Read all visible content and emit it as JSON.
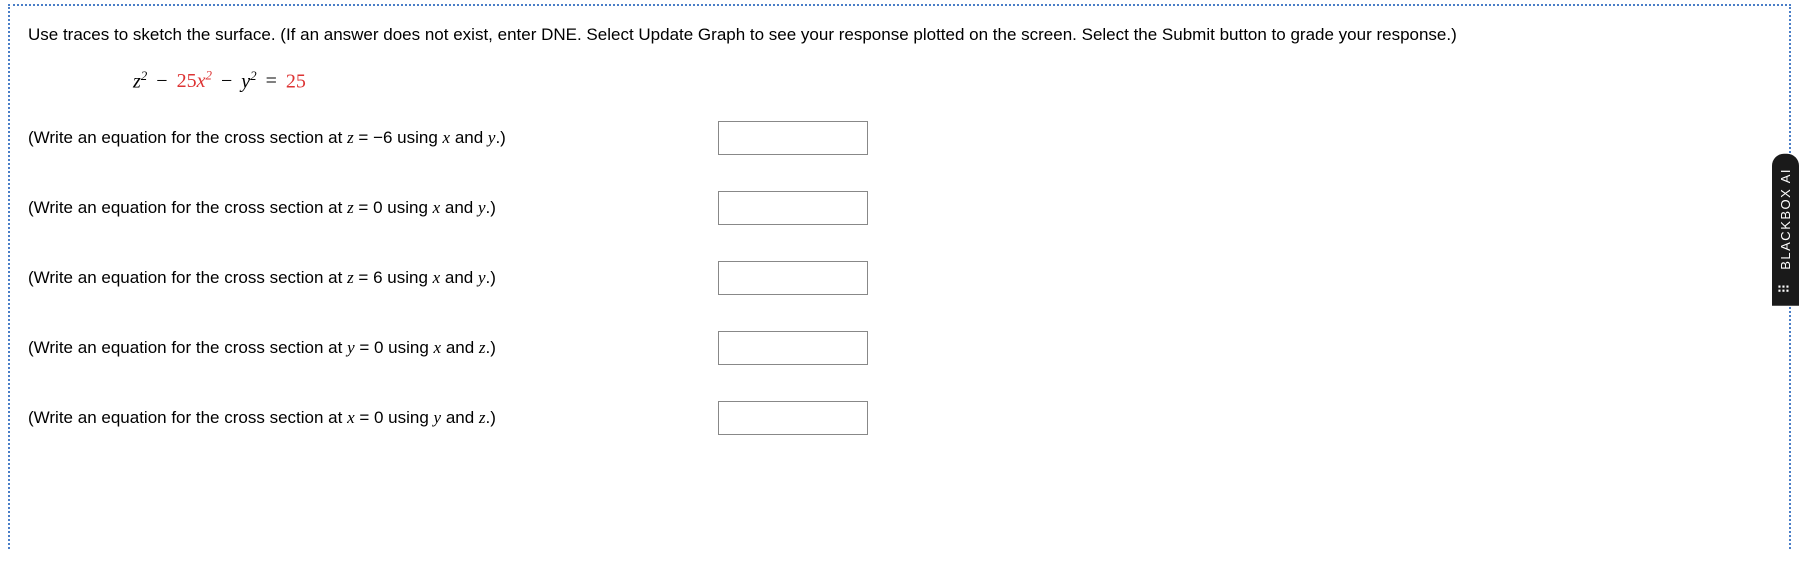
{
  "instructions": "Use traces to sketch the surface. (If an answer does not exist, enter DNE. Select Update Graph to see your response plotted on the screen. Select the Submit button to grade your response.)",
  "equation": {
    "term1": "z",
    "term1sup": "2",
    "minus1": "−",
    "coef": "25",
    "term2": "x",
    "term2sup": "2",
    "minus2": "−",
    "term3": "y",
    "term3sup": "2",
    "eq": "=",
    "rhs": "25"
  },
  "questions": [
    {
      "prefix": "(Write an equation for the cross section at ",
      "var1": "z",
      "mid": " = −6 using ",
      "var2": "x",
      "and": " and ",
      "var3": "y",
      "suffix": ".)"
    },
    {
      "prefix": "(Write an equation for the cross section at ",
      "var1": "z",
      "mid": " = 0 using ",
      "var2": "x",
      "and": " and ",
      "var3": "y",
      "suffix": ".)"
    },
    {
      "prefix": "(Write an equation for the cross section at ",
      "var1": "z",
      "mid": " = 6 using ",
      "var2": "x",
      "and": " and ",
      "var3": "y",
      "suffix": ".)"
    },
    {
      "prefix": "(Write an equation for the cross section at ",
      "var1": "y",
      "mid": " = 0 using ",
      "var2": "x",
      "and": " and ",
      "var3": "z",
      "suffix": ".)"
    },
    {
      "prefix": "(Write an equation for the cross section at ",
      "var1": "x",
      "mid": " = 0 using ",
      "var2": "y",
      "and": " and ",
      "var3": "z",
      "suffix": ".)"
    }
  ],
  "sidebar": {
    "label": "BLACKBOX AI"
  }
}
